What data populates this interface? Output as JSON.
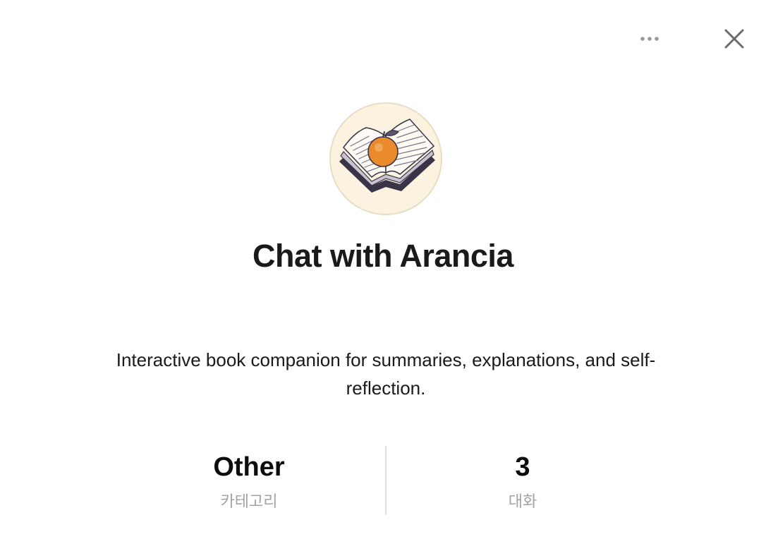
{
  "header": {
    "more_icon": "more-horizontal-icon",
    "close_icon": "close-icon"
  },
  "gpt": {
    "avatar_icon": "open-book-with-orange-icon",
    "title": "Chat with Arancia",
    "description": "Interactive book companion for summaries, explanations, and self-reflection."
  },
  "stats": [
    {
      "value": "Other",
      "label": "카테고리"
    },
    {
      "value": "3",
      "label": "대화"
    }
  ],
  "colors": {
    "avatar_bg": "#fbf3df",
    "orange": "#e98a2b",
    "muted_label": "#a3a3a3",
    "divider": "#dedede"
  }
}
